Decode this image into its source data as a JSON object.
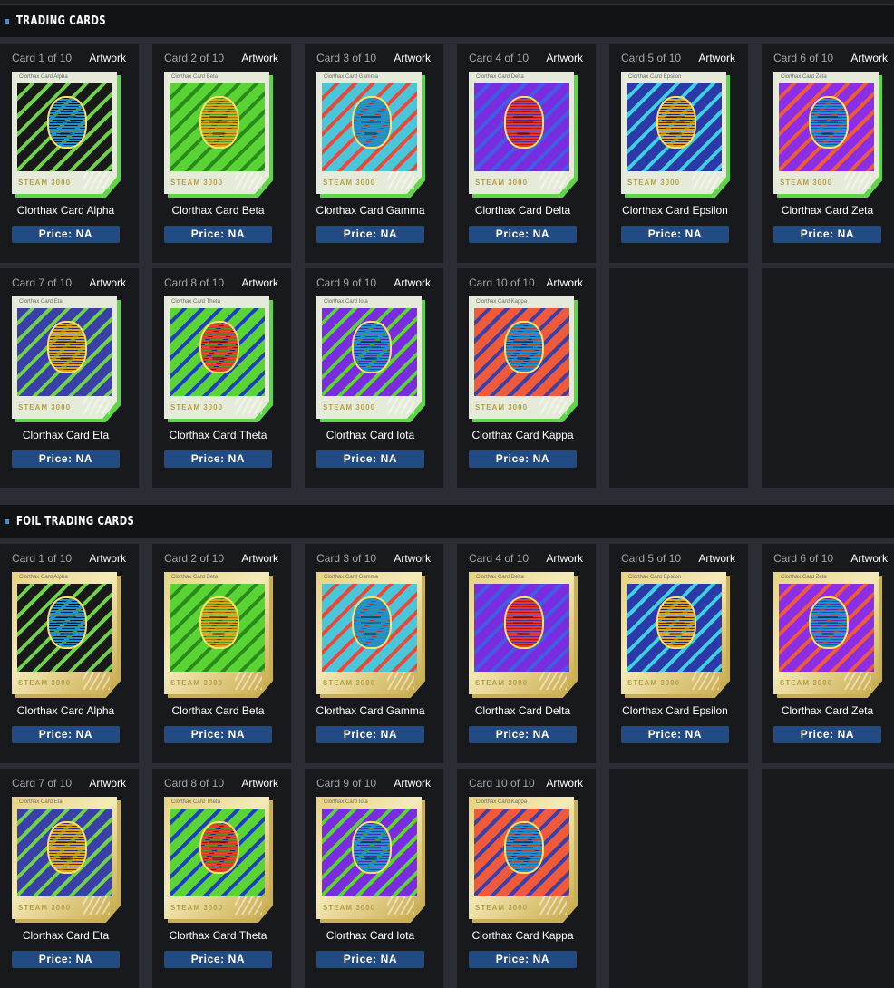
{
  "sections": [
    {
      "title": "Trading Cards",
      "kind": "normal",
      "cards": [
        {
          "counter": "Card 1 of 10",
          "artwork_label": "Artwork",
          "caption": "Clorthax Card Alpha",
          "name": "Clorthax Card Alpha",
          "brand": "STEAM 3000",
          "price": "Price: NA",
          "bg": "#1a1a1a",
          "pattern": "#6fd34a",
          "face": "#1e8fd1"
        },
        {
          "counter": "Card 2 of 10",
          "artwork_label": "Artwork",
          "caption": "Clorthax Card Beta",
          "name": "Clorthax Card Beta",
          "brand": "STEAM 3000",
          "price": "Price: NA",
          "bg": "#5ad335",
          "pattern": "#2a8a1d",
          "face": "#e0a21a"
        },
        {
          "counter": "Card 3 of 10",
          "artwork_label": "Artwork",
          "caption": "Clorthax Card Gamma",
          "name": "Clorthax Card Gamma",
          "brand": "STEAM 3000",
          "price": "Price: NA",
          "bg": "#49c6d9",
          "pattern": "#e84a3a",
          "face": "#1e8fd1"
        },
        {
          "counter": "Card 4 of 10",
          "artwork_label": "Artwork",
          "caption": "Clorthax Card Delta",
          "name": "Clorthax Card Delta",
          "brand": "STEAM 3000",
          "price": "Price: NA",
          "bg": "#7a2de0",
          "pattern": "#3f5fe0",
          "face": "#e53a2a"
        },
        {
          "counter": "Card 5 of 10",
          "artwork_label": "Artwork",
          "caption": "Clorthax Card Epsilon",
          "name": "Clorthax Card Epsilon",
          "brand": "STEAM 3000",
          "price": "Price: NA",
          "bg": "#2b3aa8",
          "pattern": "#3fd0e0",
          "face": "#e0a21a"
        },
        {
          "counter": "Card 6 of 10",
          "artwork_label": "Artwork",
          "caption": "Clorthax Card Zeta",
          "name": "Clorthax Card Zeta",
          "brand": "STEAM 3000",
          "price": "Price: NA",
          "bg": "#8b2ee6",
          "pattern": "#ef5a3a",
          "face": "#1e8fd1"
        },
        {
          "counter": "Card 7 of 10",
          "artwork_label": "Artwork",
          "caption": "Clorthax Card Eta",
          "name": "Clorthax Card Eta",
          "brand": "STEAM 3000",
          "price": "Price: NA",
          "bg": "#3b3fa8",
          "pattern": "#6fd34a",
          "face": "#e0a21a"
        },
        {
          "counter": "Card 8 of 10",
          "artwork_label": "Artwork",
          "caption": "Clorthax Card Theta",
          "name": "Clorthax Card Theta",
          "brand": "STEAM 3000",
          "price": "Price: NA",
          "bg": "#5ad335",
          "pattern": "#1f3fbf",
          "face": "#e53a2a"
        },
        {
          "counter": "Card 9 of 10",
          "artwork_label": "Artwork",
          "caption": "Clorthax Card Iota",
          "name": "Clorthax Card Iota",
          "brand": "STEAM 3000",
          "price": "Price: NA",
          "bg": "#7a2de0",
          "pattern": "#5ad335",
          "face": "#1e8fd1"
        },
        {
          "counter": "Card 10 of 10",
          "artwork_label": "Artwork",
          "caption": "Clorthax Card Kappa",
          "name": "Clorthax Card Kappa",
          "brand": "STEAM 3000",
          "price": "Price: NA",
          "bg": "#ef5a3a",
          "pattern": "#3b3fa8",
          "face": "#1e8fd1"
        }
      ]
    },
    {
      "title": "Foil Trading Cards",
      "kind": "foil",
      "cards": [
        {
          "counter": "Card 1 of 10",
          "artwork_label": "Artwork",
          "caption": "Clorthax Card Alpha",
          "name": "Clorthax Card Alpha",
          "brand": "STEAM 3000",
          "price": "Price: NA",
          "bg": "#1a1a1a",
          "pattern": "#6fd34a",
          "face": "#1e8fd1"
        },
        {
          "counter": "Card 2 of 10",
          "artwork_label": "Artwork",
          "caption": "Clorthax Card Beta",
          "name": "Clorthax Card Beta",
          "brand": "STEAM 3000",
          "price": "Price: NA",
          "bg": "#5ad335",
          "pattern": "#2a8a1d",
          "face": "#e0a21a"
        },
        {
          "counter": "Card 3 of 10",
          "artwork_label": "Artwork",
          "caption": "Clorthax Card Gamma",
          "name": "Clorthax Card Gamma",
          "brand": "STEAM 3000",
          "price": "Price: NA",
          "bg": "#49c6d9",
          "pattern": "#e84a3a",
          "face": "#1e8fd1"
        },
        {
          "counter": "Card 4 of 10",
          "artwork_label": "Artwork",
          "caption": "Clorthax Card Delta",
          "name": "Clorthax Card Delta",
          "brand": "STEAM 3000",
          "price": "Price: NA",
          "bg": "#7a2de0",
          "pattern": "#3f5fe0",
          "face": "#e53a2a"
        },
        {
          "counter": "Card 5 of 10",
          "artwork_label": "Artwork",
          "caption": "Clorthax Card Epsilon",
          "name": "Clorthax Card Epsilon",
          "brand": "STEAM 3000",
          "price": "Price: NA",
          "bg": "#2b3aa8",
          "pattern": "#3fd0e0",
          "face": "#e0a21a"
        },
        {
          "counter": "Card 6 of 10",
          "artwork_label": "Artwork",
          "caption": "Clorthax Card Zeta",
          "name": "Clorthax Card Zeta",
          "brand": "STEAM 3000",
          "price": "Price: NA",
          "bg": "#8b2ee6",
          "pattern": "#ef5a3a",
          "face": "#1e8fd1"
        },
        {
          "counter": "Card 7 of 10",
          "artwork_label": "Artwork",
          "caption": "Clorthax Card Eta",
          "name": "Clorthax Card Eta",
          "brand": "STEAM 3000",
          "price": "Price: NA",
          "bg": "#3b3fa8",
          "pattern": "#6fd34a",
          "face": "#e0a21a"
        },
        {
          "counter": "Card 8 of 10",
          "artwork_label": "Artwork",
          "caption": "Clorthax Card Theta",
          "name": "Clorthax Card Theta",
          "brand": "STEAM 3000",
          "price": "Price: NA",
          "bg": "#5ad335",
          "pattern": "#1f3fbf",
          "face": "#e53a2a"
        },
        {
          "counter": "Card 9 of 10",
          "artwork_label": "Artwork",
          "caption": "Clorthax Card Iota",
          "name": "Clorthax Card Iota",
          "brand": "STEAM 3000",
          "price": "Price: NA",
          "bg": "#7a2de0",
          "pattern": "#5ad335",
          "face": "#1e8fd1"
        },
        {
          "counter": "Card 10 of 10",
          "artwork_label": "Artwork",
          "caption": "Clorthax Card Kappa",
          "name": "Clorthax Card Kappa",
          "brand": "STEAM 3000",
          "price": "Price: NA",
          "bg": "#ef5a3a",
          "pattern": "#3b3fa8",
          "face": "#1e8fd1"
        }
      ]
    }
  ]
}
